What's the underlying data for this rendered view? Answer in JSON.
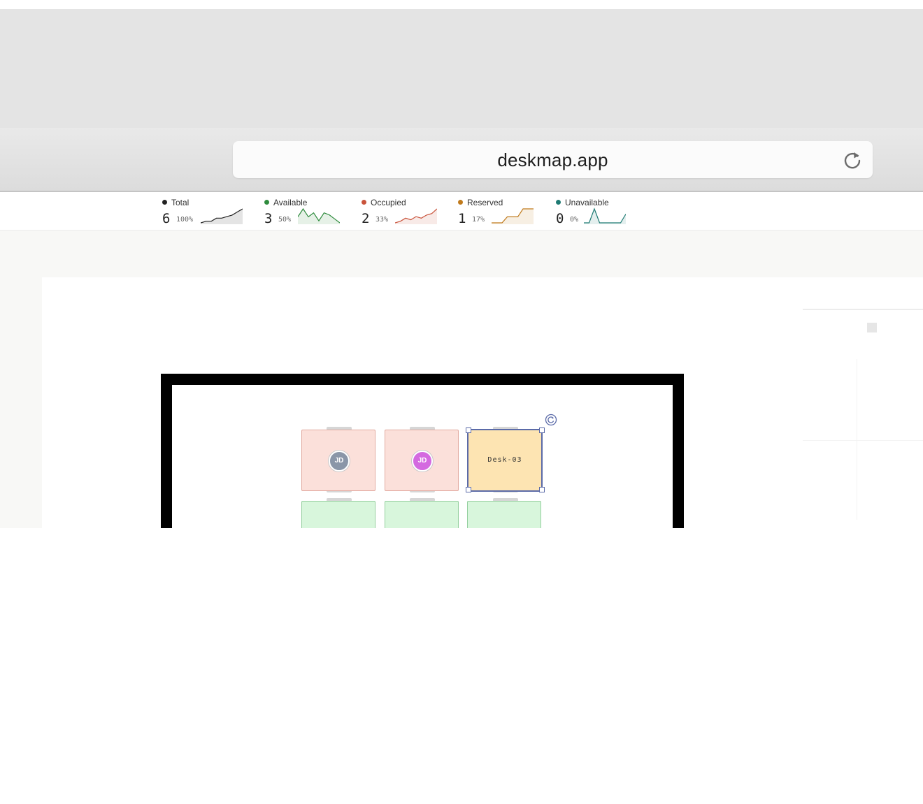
{
  "browser": {
    "url": "deskmap.app",
    "reload_icon": "reload-icon"
  },
  "stats": [
    {
      "label": "Total",
      "count": "6",
      "percent": "100%",
      "color": "#222222",
      "trend": [
        2,
        3,
        3,
        5,
        5,
        6,
        7,
        9,
        11
      ]
    },
    {
      "label": "Available",
      "count": "3",
      "percent": "50%",
      "color": "#2e8b3d",
      "trend": [
        5,
        9,
        5,
        7,
        3,
        7,
        6,
        4,
        2
      ]
    },
    {
      "label": "Occupied",
      "count": "2",
      "percent": "33%",
      "color": "#c9533b",
      "trend": [
        2,
        3,
        5,
        4,
        6,
        5,
        7,
        8,
        11
      ]
    },
    {
      "label": "Reserved",
      "count": "1",
      "percent": "17%",
      "color": "#c07a1c",
      "trend": [
        1,
        1,
        1,
        4,
        4,
        4,
        8,
        8,
        8
      ]
    },
    {
      "label": "Unavailable",
      "count": "0",
      "percent": "0%",
      "color": "#1e7a73",
      "trend": [
        1,
        1,
        9,
        1,
        1,
        1,
        1,
        1,
        6
      ]
    }
  ],
  "floor": {
    "desks": [
      {
        "status": "occupied",
        "avatar": "JD",
        "avatar_color": "#8a96a8"
      },
      {
        "status": "occupied",
        "avatar": "JD",
        "avatar_color": "#d46ae0"
      },
      {
        "status": "reserved",
        "label": "Desk-03",
        "selected": true
      },
      {
        "status": "available"
      },
      {
        "status": "available"
      },
      {
        "status": "available"
      }
    ],
    "rotate_icon": "rotate-icon"
  }
}
